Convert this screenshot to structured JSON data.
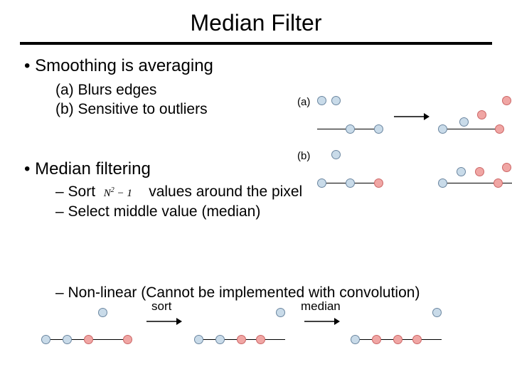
{
  "title": "Median Filter",
  "bullets": {
    "b1": "Smoothing is averaging",
    "b1_sub_a": "(a) Blurs edges",
    "b1_sub_b": "(b) Sensitive to outliers",
    "b2": "Median filtering",
    "b2_dash1_pre": "Sort",
    "b2_dash1_formula": "N",
    "b2_dash1_formula_rest": " − 1",
    "b2_dash1_post": "values around the pixel",
    "b2_dash2": "Select middle value (median)",
    "b2_dash3": "Non-linear (Cannot be implemented with convolution)"
  },
  "labels": {
    "a": "(a)",
    "b": "(b)",
    "sort": "sort",
    "median": "median"
  }
}
